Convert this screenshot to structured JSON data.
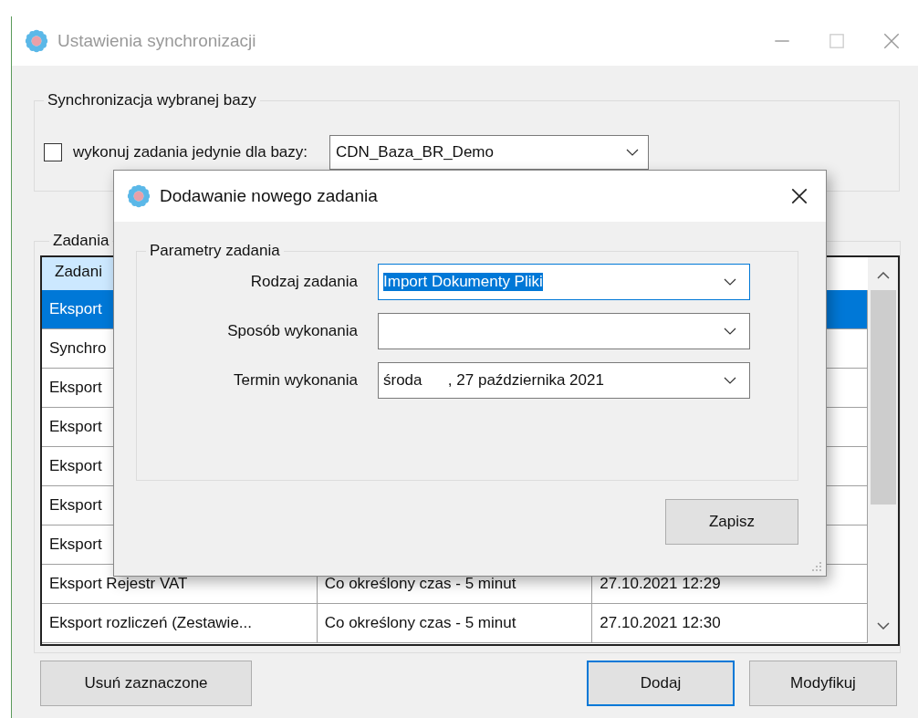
{
  "window": {
    "title": "Ustawienia synchronizacji"
  },
  "database_group": {
    "title": "Synchronizacja wybranej bazy",
    "checkbox": {
      "label": "wykonuj zadania jedynie dla bazy:",
      "checked": false
    },
    "database_combo": {
      "value": "CDN_Baza_BR_Demo"
    }
  },
  "tasks_group": {
    "title": "Zadania",
    "table": {
      "columns": [
        "Zadani"
      ],
      "rows": [
        {
          "cells": [
            "Eksport"
          ],
          "selected": true
        },
        {
          "cells": [
            "Synchro"
          ],
          "selected": false
        },
        {
          "cells": [
            "Eksport"
          ],
          "selected": false
        },
        {
          "cells": [
            "Eksport"
          ],
          "selected": false
        },
        {
          "cells": [
            "Eksport"
          ],
          "selected": false
        },
        {
          "cells": [
            "Eksport"
          ],
          "selected": false
        },
        {
          "cells": [
            "Eksport"
          ],
          "selected": false
        },
        {
          "cells": [
            "Eksport Rejestr VAT",
            "Co określony czas - 5 minut",
            "27.10.2021 12:29"
          ],
          "selected": false
        },
        {
          "cells": [
            "Eksport rozliczeń (Zestawie...",
            "Co określony czas - 5 minut",
            "27.10.2021 12:30"
          ],
          "selected": false
        }
      ]
    }
  },
  "buttons": [
    {
      "label": "Usuń zaznaczone",
      "focused": false
    },
    {
      "label": "Dodaj",
      "focused": true
    },
    {
      "label": "Modyfikuj",
      "focused": false
    }
  ],
  "dialog": {
    "title": "Dodawanie nowego zadania",
    "group_title": "Parametry zadania",
    "fields": [
      {
        "label": "Rodzaj zadania",
        "value": "Import Dokumenty Pliki",
        "focused": true
      },
      {
        "label": "Sposób wykonania",
        "focused": false
      },
      {
        "label": "Termin wykonania",
        "value": "środa      , 27 października 2021",
        "focused": false
      }
    ],
    "save_button": "Zapisz"
  }
}
